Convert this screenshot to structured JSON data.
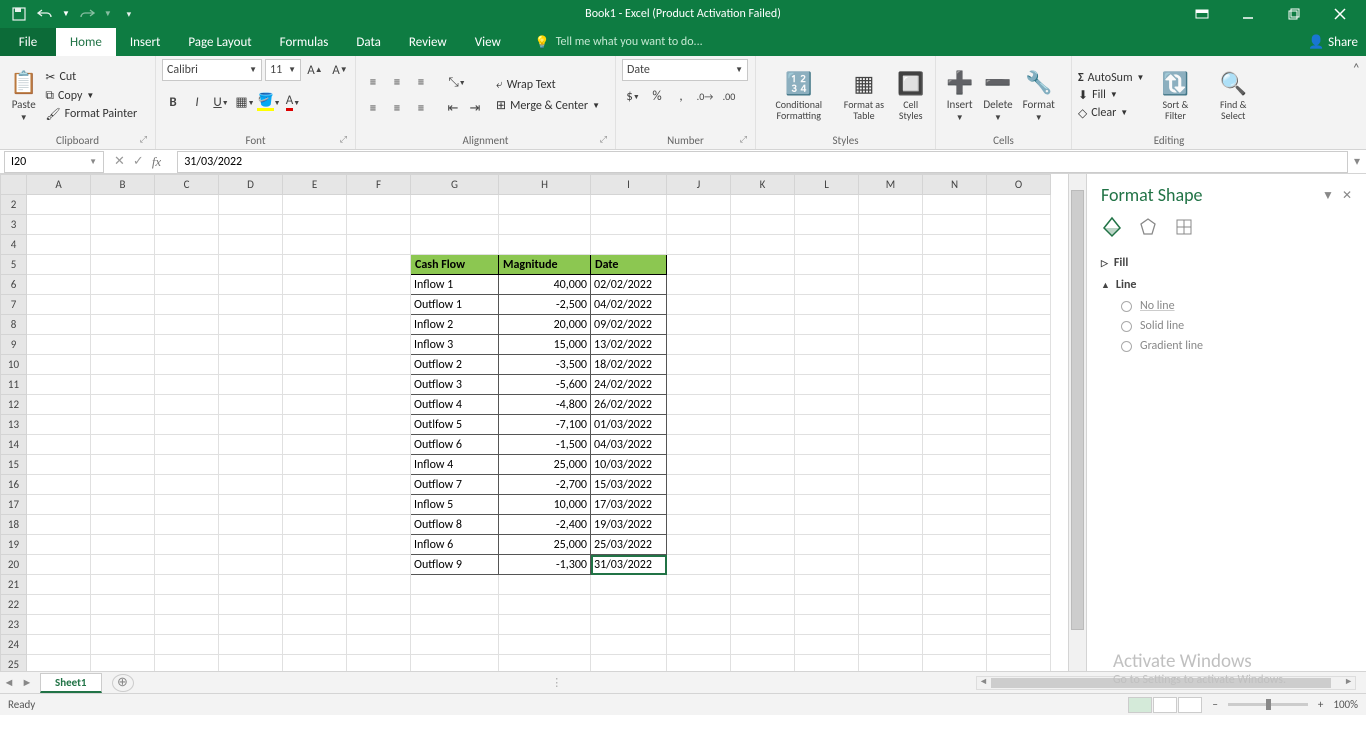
{
  "title": "Book1 - Excel (Product Activation Failed)",
  "tabs": {
    "file": "File",
    "home": "Home",
    "insert": "Insert",
    "pagelayout": "Page Layout",
    "formulas": "Formulas",
    "data": "Data",
    "review": "Review",
    "view": "View"
  },
  "tellme": "Tell me what you want to do...",
  "share": "Share",
  "ribbon": {
    "clipboard": {
      "paste": "Paste",
      "cut": "Cut",
      "copy": "Copy",
      "painter": "Format Painter",
      "label": "Clipboard"
    },
    "font": {
      "name": "Calibri",
      "size": "11",
      "label": "Font"
    },
    "alignment": {
      "wrap": "Wrap Text",
      "merge": "Merge & Center",
      "label": "Alignment"
    },
    "number": {
      "format": "Date",
      "label": "Number"
    },
    "styles": {
      "cond": "Conditional Formatting",
      "fmt": "Format as Table",
      "cell": "Cell Styles",
      "label": "Styles"
    },
    "cells": {
      "ins": "Insert",
      "del": "Delete",
      "fmt": "Format",
      "label": "Cells"
    },
    "editing": {
      "sum": "AutoSum",
      "fill": "Fill",
      "clear": "Clear",
      "sort": "Sort & Filter",
      "find": "Find & Select",
      "label": "Editing"
    }
  },
  "namebox": "I20",
  "formula": "31/03/2022",
  "columns": [
    "A",
    "B",
    "C",
    "D",
    "E",
    "F",
    "G",
    "H",
    "I",
    "J",
    "K",
    "L",
    "M",
    "N",
    "O"
  ],
  "rows": [
    2,
    3,
    4,
    5,
    6,
    7,
    8,
    9,
    10,
    11,
    12,
    13,
    14,
    15,
    16,
    17,
    18,
    19,
    20,
    21,
    22,
    23,
    24,
    25
  ],
  "table": {
    "header": {
      "g": "Cash Flow",
      "h": "Magnitude",
      "i": "Date"
    },
    "rows": [
      {
        "g": "Inflow 1",
        "h": "40,000",
        "i": "02/02/2022"
      },
      {
        "g": "Outflow 1",
        "h": "-2,500",
        "i": "04/02/2022"
      },
      {
        "g": "Inflow 2",
        "h": "20,000",
        "i": "09/02/2022"
      },
      {
        "g": "Inflow 3",
        "h": "15,000",
        "i": "13/02/2022"
      },
      {
        "g": "Outflow 2",
        "h": "-3,500",
        "i": "18/02/2022"
      },
      {
        "g": "Outflow 3",
        "h": "-5,600",
        "i": "24/02/2022"
      },
      {
        "g": "Outflow 4",
        "h": "-4,800",
        "i": "26/02/2022"
      },
      {
        "g": "Outlfow 5",
        "h": "-7,100",
        "i": "01/03/2022"
      },
      {
        "g": "Outflow 6",
        "h": "-1,500",
        "i": "04/03/2022"
      },
      {
        "g": "Inflow 4",
        "h": "25,000",
        "i": "10/03/2022"
      },
      {
        "g": "Outflow 7",
        "h": "-2,700",
        "i": "15/03/2022"
      },
      {
        "g": "Inflow 5",
        "h": "10,000",
        "i": "17/03/2022"
      },
      {
        "g": "Outflow 8",
        "h": "-2,400",
        "i": "19/03/2022"
      },
      {
        "g": "Inflow 6",
        "h": "25,000",
        "i": "25/03/2022"
      },
      {
        "g": "Outflow 9",
        "h": "-1,300",
        "i": "31/03/2022"
      }
    ]
  },
  "panel": {
    "title": "Format Shape",
    "fill": "Fill",
    "line": "Line",
    "noline": "No line",
    "solid": "Solid line",
    "grad": "Gradient line"
  },
  "sheet_tab": "Sheet1",
  "status": "Ready",
  "zoom": "100%",
  "watermark": {
    "l1": "Activate Windows",
    "l2": "Go to Settings to activate Windows."
  }
}
